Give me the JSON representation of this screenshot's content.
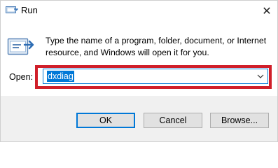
{
  "window": {
    "title": "Run",
    "close_glyph": "✕"
  },
  "description_lines": [
    "Type the name of a program, folder, document, or Internet",
    "resource, and Windows will open it for you."
  ],
  "open": {
    "label": "Open:",
    "value": "dxdiag"
  },
  "buttons": {
    "ok": "OK",
    "cancel": "Cancel",
    "browse": "Browse..."
  },
  "icons": {
    "app": "run-icon",
    "large": "run-large-icon",
    "dropdown": "chevron-down-icon",
    "close": "close-icon"
  },
  "colors": {
    "highlight": "#d01f2a",
    "accent": "#0078d7",
    "footer": "#f0f0f0"
  }
}
